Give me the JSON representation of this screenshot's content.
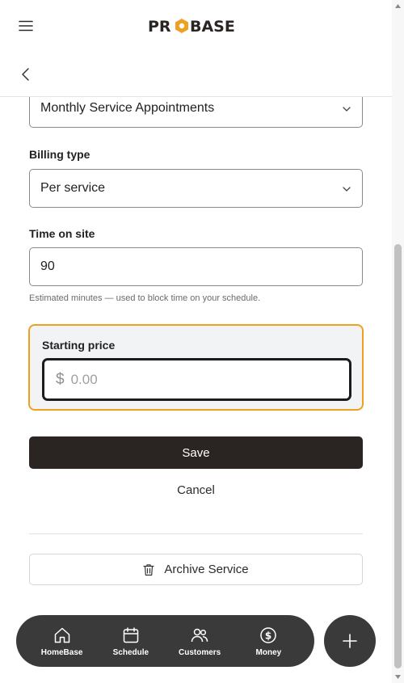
{
  "header": {
    "logo_text": "PROBASE",
    "menu_icon": "hamburger-menu-icon",
    "back_icon": "chevron-left-icon"
  },
  "form": {
    "service_select": {
      "value": "Monthly Service Appointments"
    },
    "billing_type": {
      "label": "Billing type",
      "value": "Per service"
    },
    "time_on_site": {
      "label": "Time on site",
      "value": "90",
      "hint": "Estimated minutes — used to block time on your schedule."
    },
    "starting_price": {
      "label": "Starting price",
      "currency": "$",
      "placeholder": "0.00",
      "value": ""
    }
  },
  "actions": {
    "save_label": "Save",
    "cancel_label": "Cancel",
    "archive_label": "Archive Service"
  },
  "bottom_nav": {
    "items": [
      {
        "label": "HomeBase",
        "icon": "home-icon"
      },
      {
        "label": "Schedule",
        "icon": "calendar-icon"
      },
      {
        "label": "Customers",
        "icon": "users-icon"
      },
      {
        "label": "Money",
        "icon": "dollar-circle-icon"
      }
    ],
    "fab_icon": "plus-icon"
  },
  "colors": {
    "accent": "#f0a020",
    "dark": "#2a2522",
    "nav_bg": "#3a3a3a",
    "panel_bg": "#f1f3f4"
  }
}
